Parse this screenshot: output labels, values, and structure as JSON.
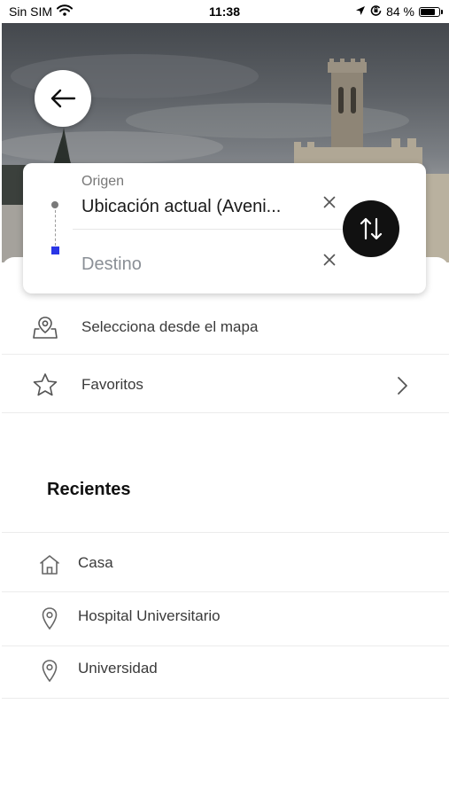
{
  "status_bar": {
    "carrier": "Sin SIM",
    "time": "11:38",
    "battery_text": "84 %",
    "battery_level": 0.84,
    "icons": [
      "wifi-icon",
      "location-arrow-icon",
      "orientation-lock-icon",
      "battery-icon"
    ]
  },
  "header": {
    "back_icon": "arrow-left-icon"
  },
  "route": {
    "origin_label": "Origen",
    "origin_value": "Ubicación actual (Aveni...",
    "destination_placeholder": "Destino",
    "destination_value": "",
    "clear_icon": "close-icon",
    "swap_icon": "swap-vertical-icon",
    "destination_marker_color": "#2a36e6"
  },
  "options": [
    {
      "label": "Selecciona desde el mapa",
      "icon": "map-pin-icon"
    },
    {
      "label": "Favoritos",
      "icon": "star-icon",
      "chevron": "chevron-right-icon"
    }
  ],
  "recents": {
    "title": "Recientes",
    "items": [
      {
        "label": "Casa",
        "icon": "home-icon"
      },
      {
        "label": "Hospital Universitario",
        "icon": "location-pin-icon"
      },
      {
        "label": "Universidad",
        "icon": "location-pin-icon"
      }
    ]
  }
}
